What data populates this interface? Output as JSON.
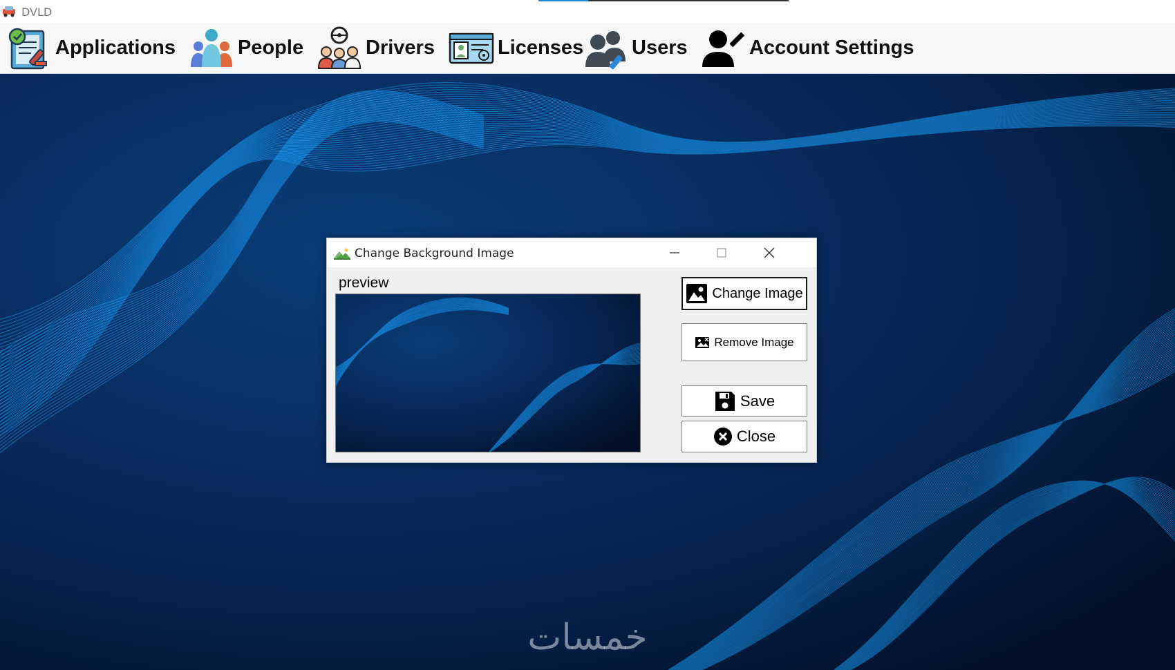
{
  "app": {
    "title": "DVLD",
    "icon": "car-icon"
  },
  "menu": {
    "items": [
      {
        "label": "Applications",
        "icon": "applications-icon"
      },
      {
        "label": "People",
        "icon": "people-icon"
      },
      {
        "label": "Drivers",
        "icon": "drivers-icon"
      },
      {
        "label": "Licenses",
        "icon": "license-card-icon"
      },
      {
        "label": "Users",
        "icon": "users-icon"
      },
      {
        "label": "Account Settings",
        "icon": "account-edit-icon"
      }
    ]
  },
  "dialog": {
    "title": "Change Background Image",
    "icon": "landscape-image-icon",
    "window_buttons": [
      "minimize",
      "maximize",
      "close"
    ],
    "preview_label": "preview",
    "buttons": {
      "change_image": "Change Image",
      "remove_image": "Remove Image",
      "save": "Save",
      "close": "Close"
    }
  },
  "watermark": {
    "text": "خمسات"
  },
  "colors": {
    "accent_blue": "#1e88e5",
    "desktop_dark": "#041a3a",
    "wave_cyan": "#1aa3ff",
    "dialog_bg": "#f0f0f0"
  }
}
